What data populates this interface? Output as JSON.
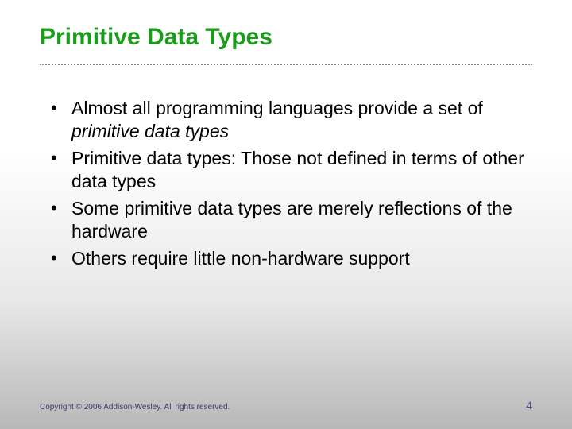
{
  "title": "Primitive Data Types",
  "bullets": [
    {
      "pre": "Almost all programming languages provide a set of ",
      "em": "primitive data types",
      "post": ""
    },
    {
      "pre": "Primitive data types: Those not defined in terms of other data types",
      "em": "",
      "post": ""
    },
    {
      "pre": "Some primitive data types are merely reflections of the hardware",
      "em": "",
      "post": ""
    },
    {
      "pre": "Others require little non-hardware support",
      "em": "",
      "post": ""
    }
  ],
  "footer": {
    "copyright": "Copyright © 2006 Addison-Wesley. All rights reserved.",
    "page": "4"
  }
}
